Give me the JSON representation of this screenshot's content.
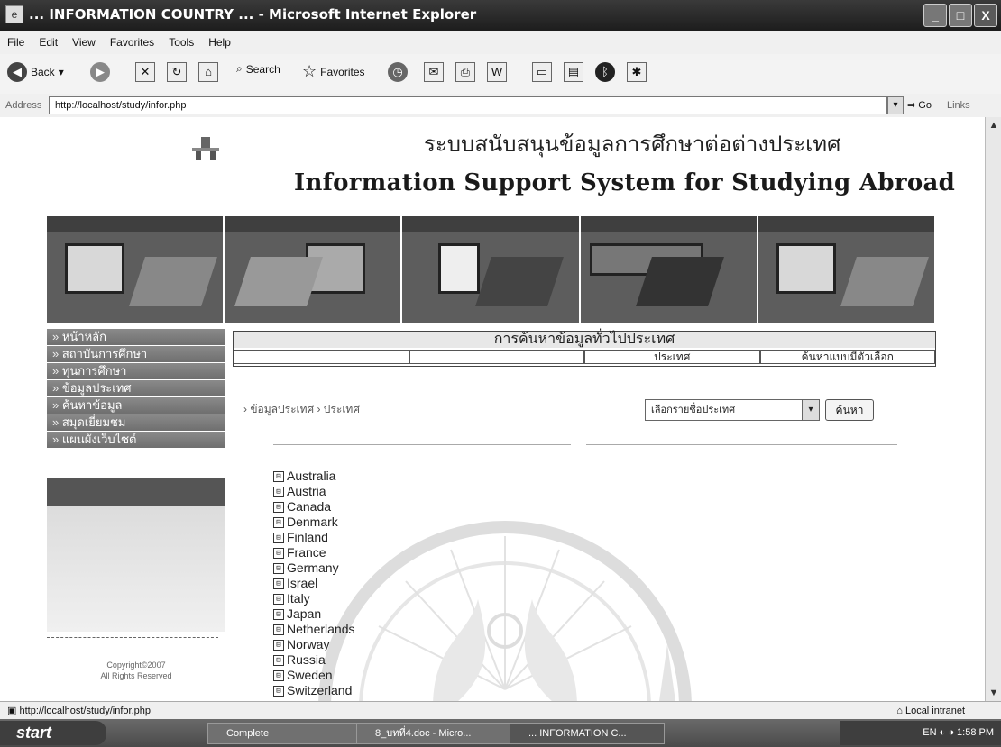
{
  "window": {
    "title": "... INFORMATION COUNTRY ... - Microsoft Internet Explorer",
    "buttons": [
      "_",
      "□",
      "X"
    ]
  },
  "menu": [
    "File",
    "Edit",
    "View",
    "Favorites",
    "Tools",
    "Help"
  ],
  "toolbar": {
    "back": "Back",
    "search": "Search",
    "favorites": "Favorites"
  },
  "address": {
    "label": "Address",
    "url": "http://localhost/study/infor.php",
    "go": "Go",
    "links": "Links"
  },
  "page": {
    "thai_title": "ระบบสนับสนุนข้อมูลการศึกษาต่อต่างประเทศ",
    "english_title": "Information Support System for Studying Abroad",
    "sidebar": [
      "หน้าหลัก",
      "สถาบันการศึกษา",
      "ทุนการศึกษา",
      "ข้อมูลประเทศ",
      "ค้นหาข้อมูล",
      "สมุดเยี่ยมชม",
      "แผนผังเว็บไซต์"
    ],
    "copyright": [
      "Copyright©2007",
      "All Rights Reserved"
    ],
    "content_title": "การค้นหาข้อมูลทั่วไปประเทศ",
    "columns": [
      "",
      "",
      "ประเทศ",
      "ค้นหาแบบมีตัวเลือก"
    ],
    "breadcrumb": "› ข้อมูลประเทศ › ประเทศ",
    "select_value": "เลือกรายชื่อประเทศ",
    "search_button": "ค้นหา",
    "countries": [
      "Australia",
      "Austria",
      "Canada",
      "Denmark",
      "Finland",
      "France",
      "Germany",
      "Israel",
      "Italy",
      "Japan",
      "Netherlands",
      "Norway",
      "Russia",
      "Sweden",
      "Switzerland"
    ]
  },
  "status": {
    "url": "http://localhost/study/infor.php",
    "zone": "Local intranet"
  },
  "taskbar": {
    "start": "start",
    "tasks": [
      "Complete",
      "8_บทที่4.doc - Micro...",
      "... INFORMATION C..."
    ],
    "lang": "EN",
    "time": "1:58 PM"
  }
}
